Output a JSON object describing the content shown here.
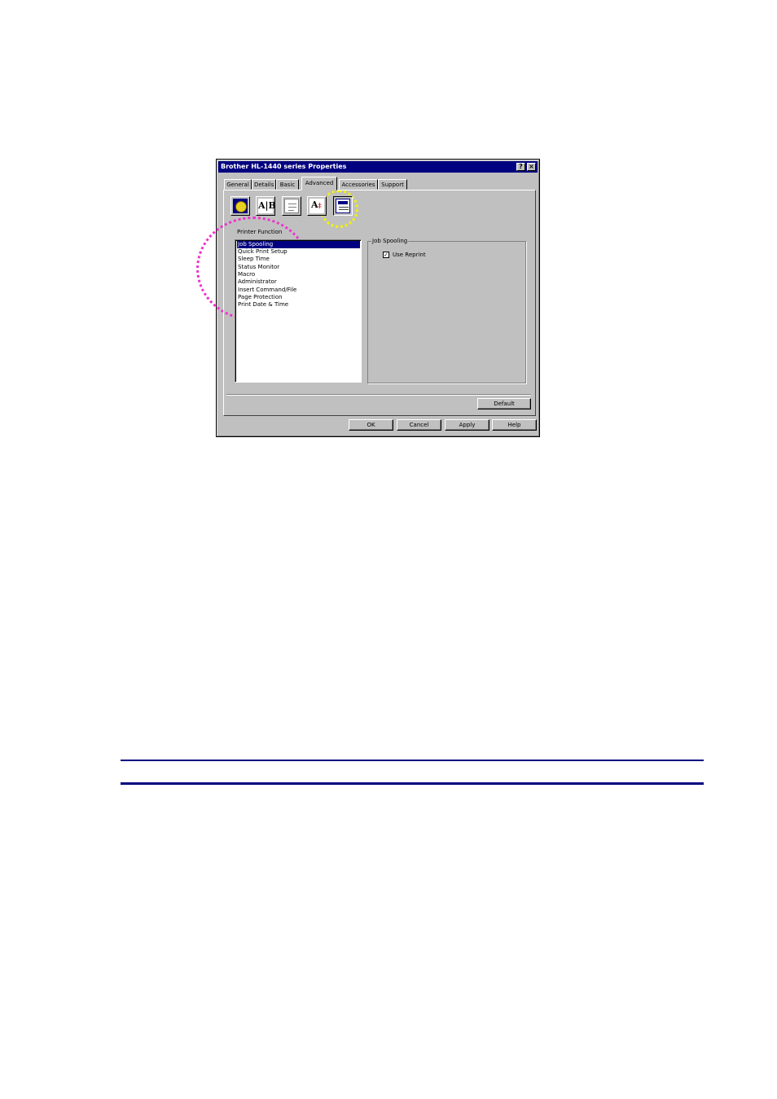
{
  "window": {
    "title": "Brother HL-1440 series Properties",
    "help_btn": "?",
    "close_btn": "×"
  },
  "tabs": [
    "General",
    "Details",
    "Basic",
    "Advanced",
    "Accessories",
    "Support"
  ],
  "active_tab": "Advanced",
  "toolbar_icons": [
    "print-quality-icon",
    "duplex-icon",
    "watermark-icon",
    "page-setting-icon",
    "device-options-icon"
  ],
  "printer_function": {
    "label": "Printer Function",
    "items": [
      "Job Spooling",
      "Quick Print Setup",
      "Sleep Time",
      "Status Monitor",
      "Macro",
      "Administrator",
      "Insert Command/File",
      "Page Protection",
      "Print Date & Time"
    ],
    "selected": "Job Spooling"
  },
  "job_spooling": {
    "group_title": "Job Spooling",
    "use_reprint_label": "Use Reprint",
    "use_reprint_checked": true,
    "check_mark": "✓"
  },
  "buttons": {
    "default": "Default",
    "ok": "OK",
    "cancel": "Cancel",
    "apply": "Apply",
    "help": "Help"
  },
  "colors": {
    "highlight_magenta": "#ee33cc",
    "highlight_yellow": "#f2f20a",
    "titlebar": "#000080"
  }
}
